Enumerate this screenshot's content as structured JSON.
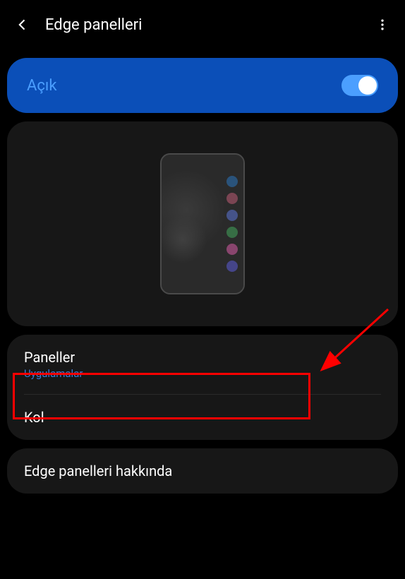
{
  "header": {
    "title": "Edge panelleri"
  },
  "toggle": {
    "label": "Açık",
    "state": "on"
  },
  "list": {
    "items": [
      {
        "title": "Paneller",
        "subtitle": "Uygulamalar"
      },
      {
        "title": "Kol"
      }
    ]
  },
  "about": {
    "title": "Edge panelleri hakkında"
  },
  "annotation": {
    "highlight_target": "paneller-item"
  }
}
